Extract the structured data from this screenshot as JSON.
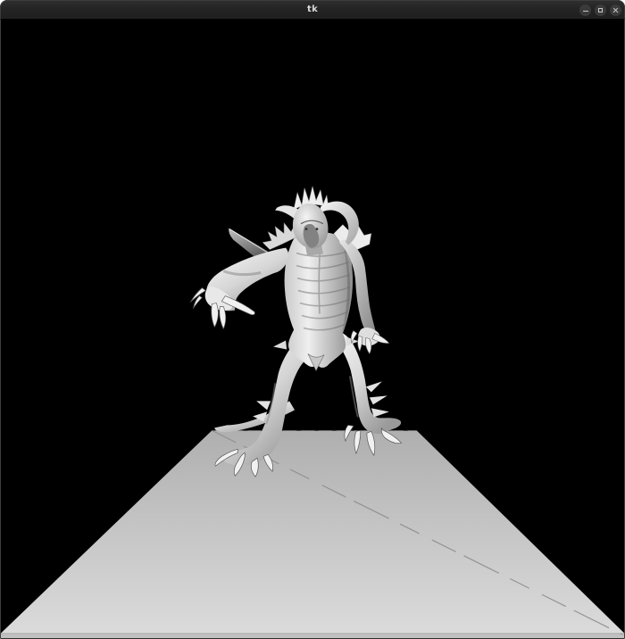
{
  "window": {
    "title": "tk",
    "controls": {
      "minimize": "minimize",
      "maximize": "maximize",
      "close": "close"
    }
  },
  "scene": {
    "background_color": "#000000",
    "floor": {
      "near_color": "#dcdcdc",
      "far_color": "#b1b1b1",
      "seam_color": "#8d8d8d",
      "shape": "perspective ground plane with dashed diagonal seam"
    },
    "model": {
      "name": "horned demon creature statue",
      "base_color": "#e6e6e6",
      "pose": "standing on two clawed feet, left arm raised with claws, tail to lower left, curled horns"
    }
  }
}
